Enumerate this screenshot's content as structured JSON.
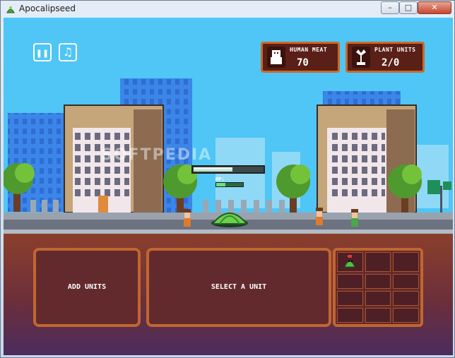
{
  "window": {
    "title": "Apocalipseed",
    "minimize_symbol": "–",
    "maximize_symbol": "□",
    "close_symbol": "✕"
  },
  "hud": {
    "pause_symbol": "❚❚",
    "music_symbol": "♫",
    "human_meat": {
      "label": "HUMAN MEAT",
      "value": "70",
      "icon": "human-icon"
    },
    "plant_units": {
      "label": "PLANT UNITS",
      "value": "2/0",
      "icon": "plant-icon"
    }
  },
  "seed": {
    "hp_label": "HP:",
    "hp_fraction": 0.35,
    "spawn_progress": 0.55
  },
  "bottom": {
    "add_units_label": "ADD UNITS",
    "select_unit_label": "SELECT A UNIT"
  },
  "watermark": "SOFTPEDIA",
  "colors": {
    "sky": "#4fc6f6",
    "panel_fill": "#632a2e",
    "panel_border": "#c1662f",
    "dirt": "#8a3f2c"
  }
}
